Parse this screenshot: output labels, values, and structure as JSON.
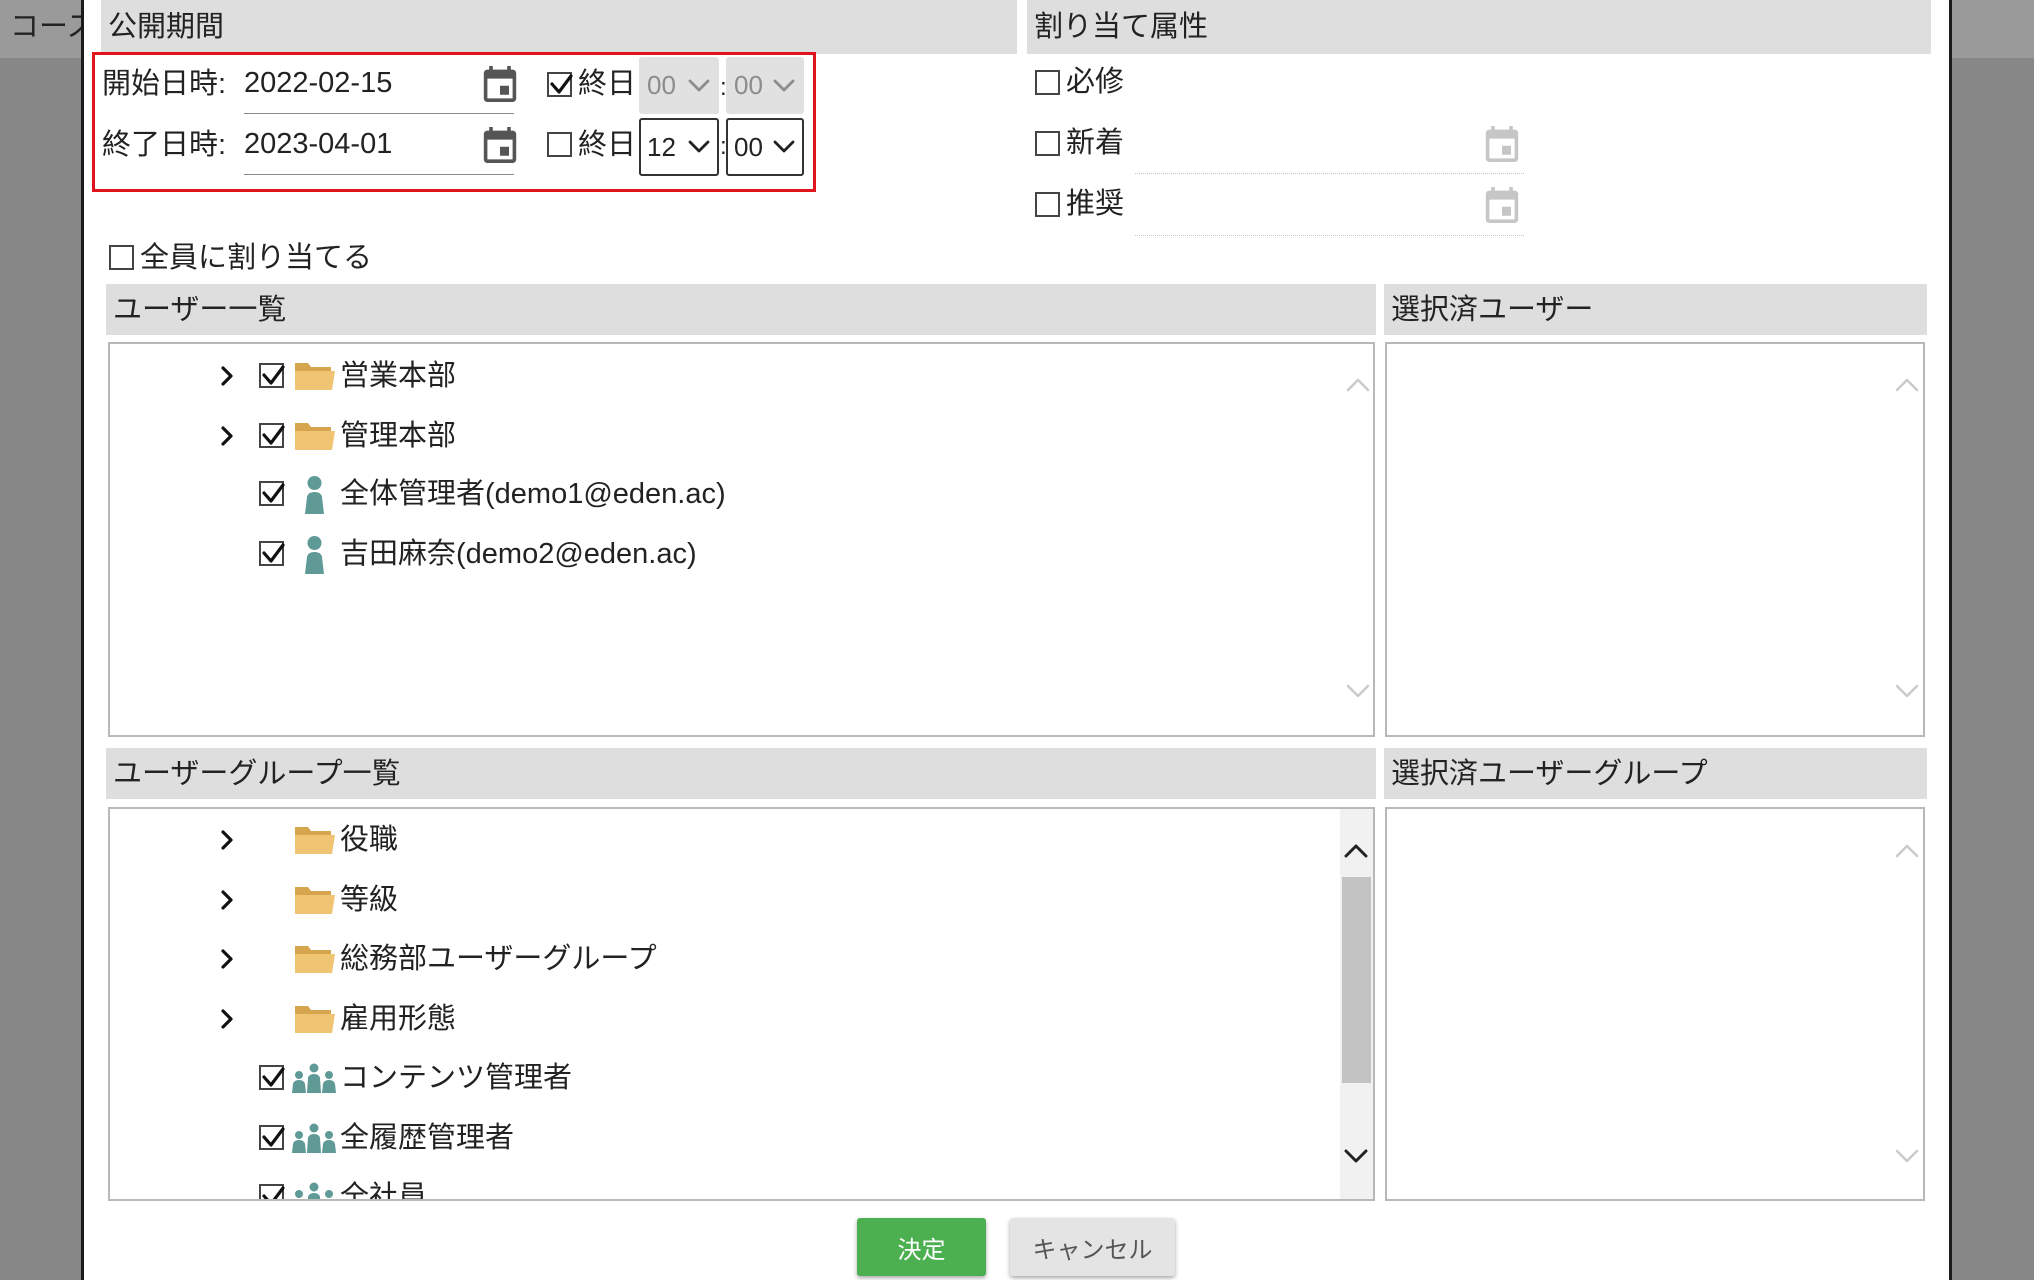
{
  "background": {
    "page_title": "コース"
  },
  "publish_period": {
    "title": "公開期間",
    "time_separator": ":",
    "start": {
      "label": "開始日時:",
      "date": "2022-02-15",
      "all_day_label": "終日",
      "all_day_checked": true,
      "hour": "00",
      "minute": "00",
      "time_disabled": true
    },
    "end": {
      "label": "終了日時:",
      "date": "2023-04-01",
      "all_day_label": "終日",
      "all_day_checked": false,
      "hour": "12",
      "minute": "00",
      "time_disabled": false
    }
  },
  "attributes": {
    "title": "割り当て属性",
    "required": {
      "label": "必修",
      "checked": false
    },
    "new": {
      "label": "新着",
      "checked": false,
      "date": ""
    },
    "recommended": {
      "label": "推奨",
      "checked": false,
      "date": ""
    }
  },
  "assign_all": {
    "label": "全員に割り当てる",
    "checked": false
  },
  "users": {
    "title": "ユーザー一覧",
    "items": [
      {
        "label": "営業本部",
        "icon": "folder-icon",
        "expandable": true,
        "checked": false
      },
      {
        "label": "管理本部",
        "icon": "folder-icon",
        "expandable": true,
        "checked": false
      },
      {
        "label": "全体管理者(demo1@eden.ac)",
        "icon": "user-icon",
        "expandable": false,
        "checked": false
      },
      {
        "label": "吉田麻奈(demo2@eden.ac)",
        "icon": "user-icon",
        "expandable": false,
        "checked": false
      }
    ]
  },
  "selected_users": {
    "title": "選択済ユーザー",
    "items": []
  },
  "user_groups": {
    "title": "ユーザーグループ一覧",
    "items": [
      {
        "label": "役職",
        "icon": "folder-icon",
        "expandable": true
      },
      {
        "label": "等級",
        "icon": "folder-icon",
        "expandable": true
      },
      {
        "label": "総務部ユーザーグループ",
        "icon": "folder-icon",
        "expandable": true
      },
      {
        "label": "雇用形態",
        "icon": "folder-icon",
        "expandable": true
      },
      {
        "label": "コンテンツ管理者",
        "icon": "user-group-icon",
        "expandable": false,
        "checked": false
      },
      {
        "label": "全履歴管理者",
        "icon": "user-group-icon",
        "expandable": false,
        "checked": false
      },
      {
        "label": "全社員",
        "icon": "user-group-icon",
        "expandable": false,
        "checked": false
      }
    ]
  },
  "selected_user_groups": {
    "title": "選択済ユーザーグループ",
    "items": []
  },
  "buttons": {
    "confirm": "決定",
    "cancel": "キャンセル"
  },
  "colors": {
    "highlight_border": "#e1141e",
    "confirm_button": "#4caf50",
    "header_background": "#dedede",
    "folder": "#efc472",
    "user_icon": "#5f9a97"
  }
}
